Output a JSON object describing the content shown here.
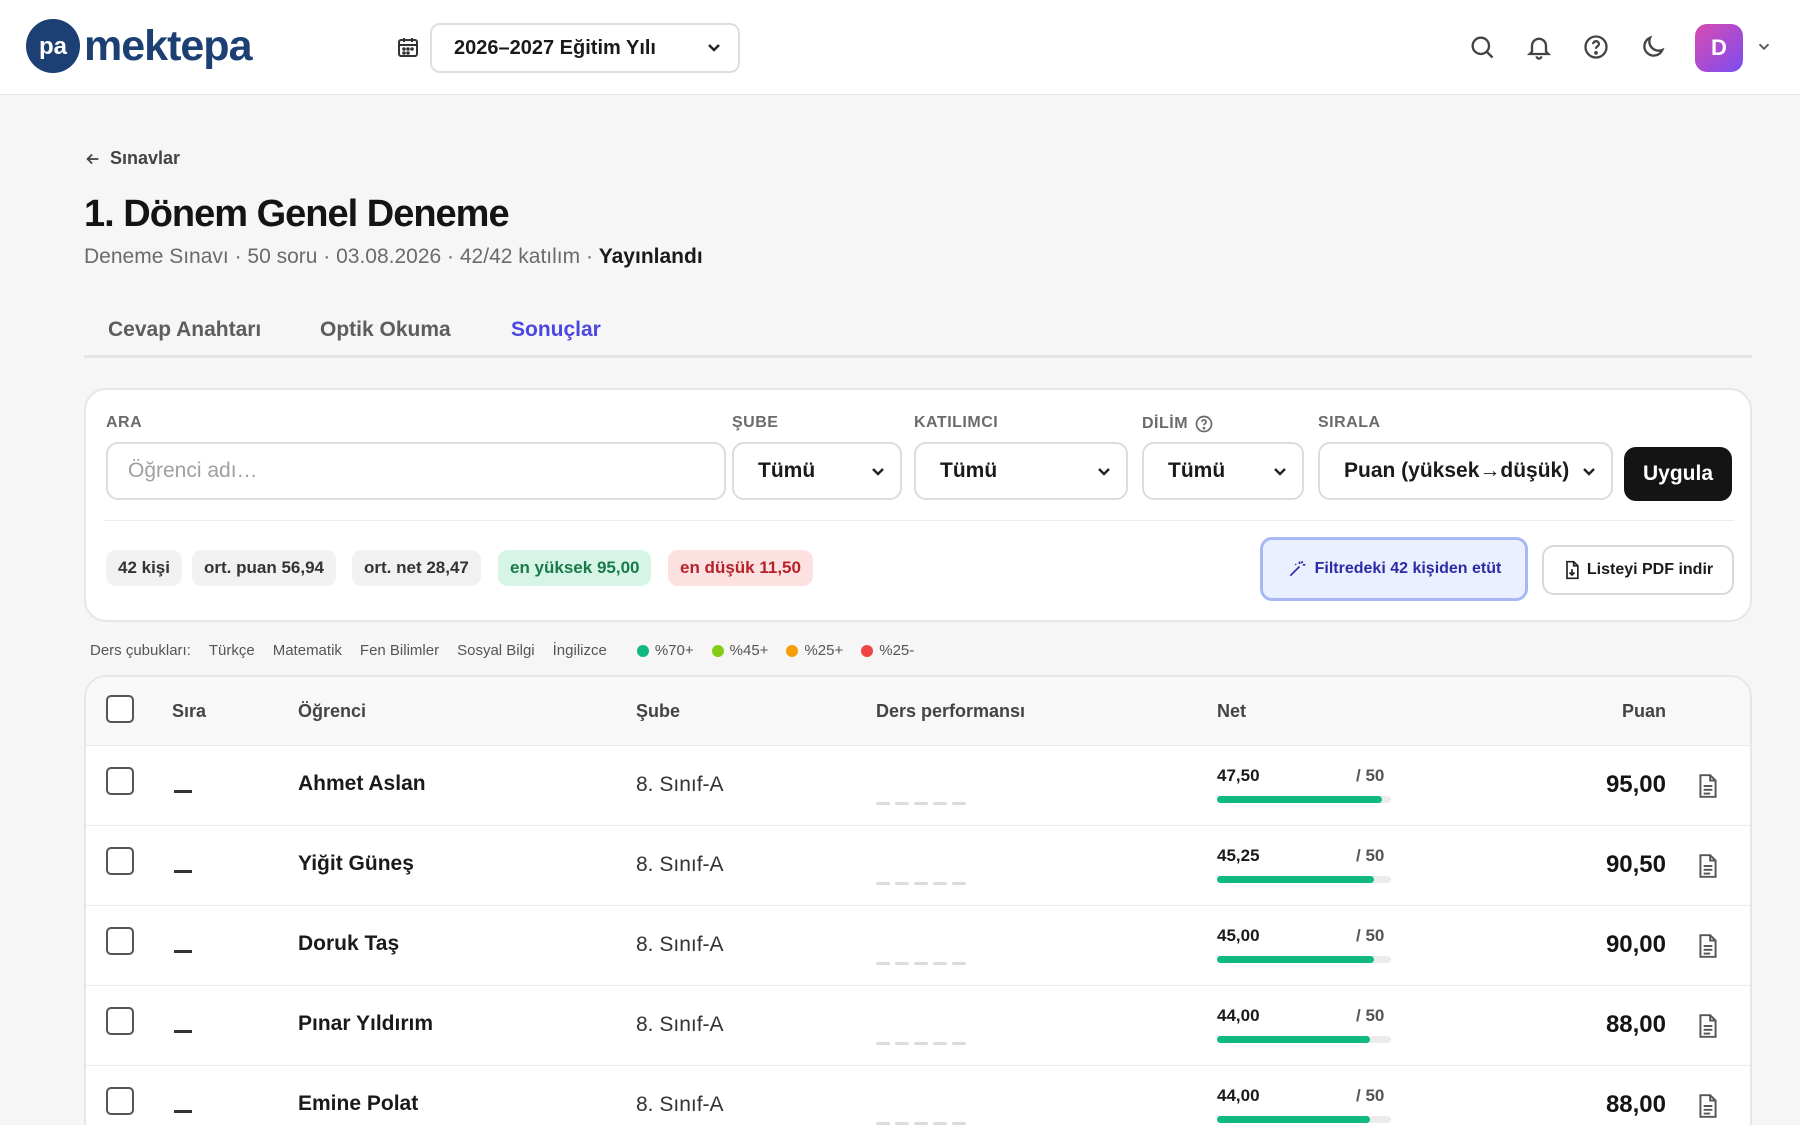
{
  "header": {
    "logo_text": "mektepa",
    "logo_mark": "pa",
    "year_select": "2026–2027 Eğitim Yılı",
    "avatar_initial": "D",
    "icons": [
      "calendar-icon",
      "search-icon",
      "bell-icon",
      "help-icon",
      "moon-icon",
      "chevron-down-icon"
    ]
  },
  "breadcrumb": {
    "back_label": "Sınavlar"
  },
  "page": {
    "title": "1. Dönem Genel Deneme",
    "meta": "Deneme Sınavı · 50 soru · 03.08.2026 · 42/42 katılım · ",
    "status": "Yayınlandı"
  },
  "tabs": [
    {
      "label": "Cevap Anahtarı",
      "active": false
    },
    {
      "label": "Optik Okuma",
      "active": false
    },
    {
      "label": "Sonuçlar",
      "active": true
    }
  ],
  "filters": {
    "search_label": "ARA",
    "search_placeholder": "Öğrenci adı…",
    "sube_label": "ŞUBE",
    "sube_value": "Tümü",
    "katilimci_label": "KATILIMCI",
    "katilimci_value": "Tümü",
    "dilim_label": "DİLİM",
    "dilim_value": "Tümü",
    "sirala_label": "SIRALA",
    "sirala_value": "Puan (yüksek→düşük)",
    "apply": "Uygula"
  },
  "stats": {
    "count": "42 kişi",
    "avg_score": "ort. puan 56,94",
    "avg_net": "ort. net 28,47",
    "max": "en yüksek 95,00",
    "min": "en düşük 11,50"
  },
  "actions": {
    "study": "Filtredeki 42 kişiden etüt",
    "pdf": "Listeyi PDF indir"
  },
  "legend": {
    "label": "Ders çubukları:",
    "subjects": [
      "Türkçe",
      "Matematik",
      "Fen Bilimler",
      "Sosyal Bilgi",
      "İngilizce"
    ],
    "bands": [
      {
        "label": "%70+",
        "color": "#10b980"
      },
      {
        "label": "%45+",
        "color": "#84cc16"
      },
      {
        "label": "%25+",
        "color": "#f59e0b"
      },
      {
        "label": "%25-",
        "color": "#ef4444"
      }
    ]
  },
  "table": {
    "columns": {
      "rank": "Sıra",
      "student": "Öğrenci",
      "class": "Şube",
      "perf": "Ders performansı",
      "net": "Net",
      "score": "Puan"
    },
    "rows": [
      {
        "rank": "—",
        "name": "Ahmet Aslan",
        "class": "8. Sınıf-A",
        "net": "47,50",
        "net_max": "/ 50",
        "net_value": 47.5,
        "score": "95,00"
      },
      {
        "rank": "—",
        "name": "Yiğit Güneş",
        "class": "8. Sınıf-A",
        "net": "45,25",
        "net_max": "/ 50",
        "net_value": 45.25,
        "score": "90,50"
      },
      {
        "rank": "—",
        "name": "Doruk Taş",
        "class": "8. Sınıf-A",
        "net": "45,00",
        "net_max": "/ 50",
        "net_value": 45.0,
        "score": "90,00"
      },
      {
        "rank": "—",
        "name": "Pınar Yıldırım",
        "class": "8. Sınıf-A",
        "net": "44,00",
        "net_max": "/ 50",
        "net_value": 44.0,
        "score": "88,00"
      },
      {
        "rank": "—",
        "name": "Emine Polat",
        "class": "8. Sınıf-A",
        "net": "44,00",
        "net_max": "/ 50",
        "net_value": 44.0,
        "score": "88,00"
      }
    ]
  }
}
